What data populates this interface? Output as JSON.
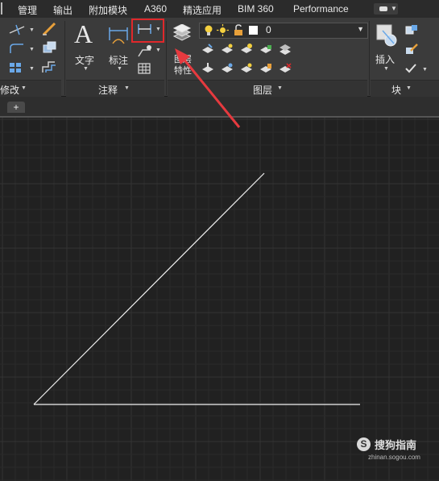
{
  "menubar": {
    "items": [
      "管理",
      "输出",
      "附加模块",
      "A360",
      "精选应用",
      "BIM 360",
      "Performance"
    ]
  },
  "ribbon": {
    "annotation": {
      "text_label": "文字",
      "dimension_label": "标注",
      "panel_title": "注释"
    },
    "modify_panel_title": "修改",
    "layers": {
      "current_layer": "0",
      "props_label_line1": "图层",
      "props_label_line2": "特性",
      "panel_title": "图层"
    },
    "block": {
      "insert_label": "插入",
      "panel_title": "块"
    }
  },
  "tabs": {
    "new_tab": "+"
  },
  "drawing": {
    "background": "#212121",
    "grid_minor": "#2a2a2a",
    "grid_major": "#343434",
    "line_color": "#f2f2f2"
  },
  "watermark": {
    "brand": "搜狗指南",
    "url": "zhinan.sogou.com"
  },
  "colors": {
    "highlight": "#e0282b",
    "arrow": "#e63a3f"
  }
}
